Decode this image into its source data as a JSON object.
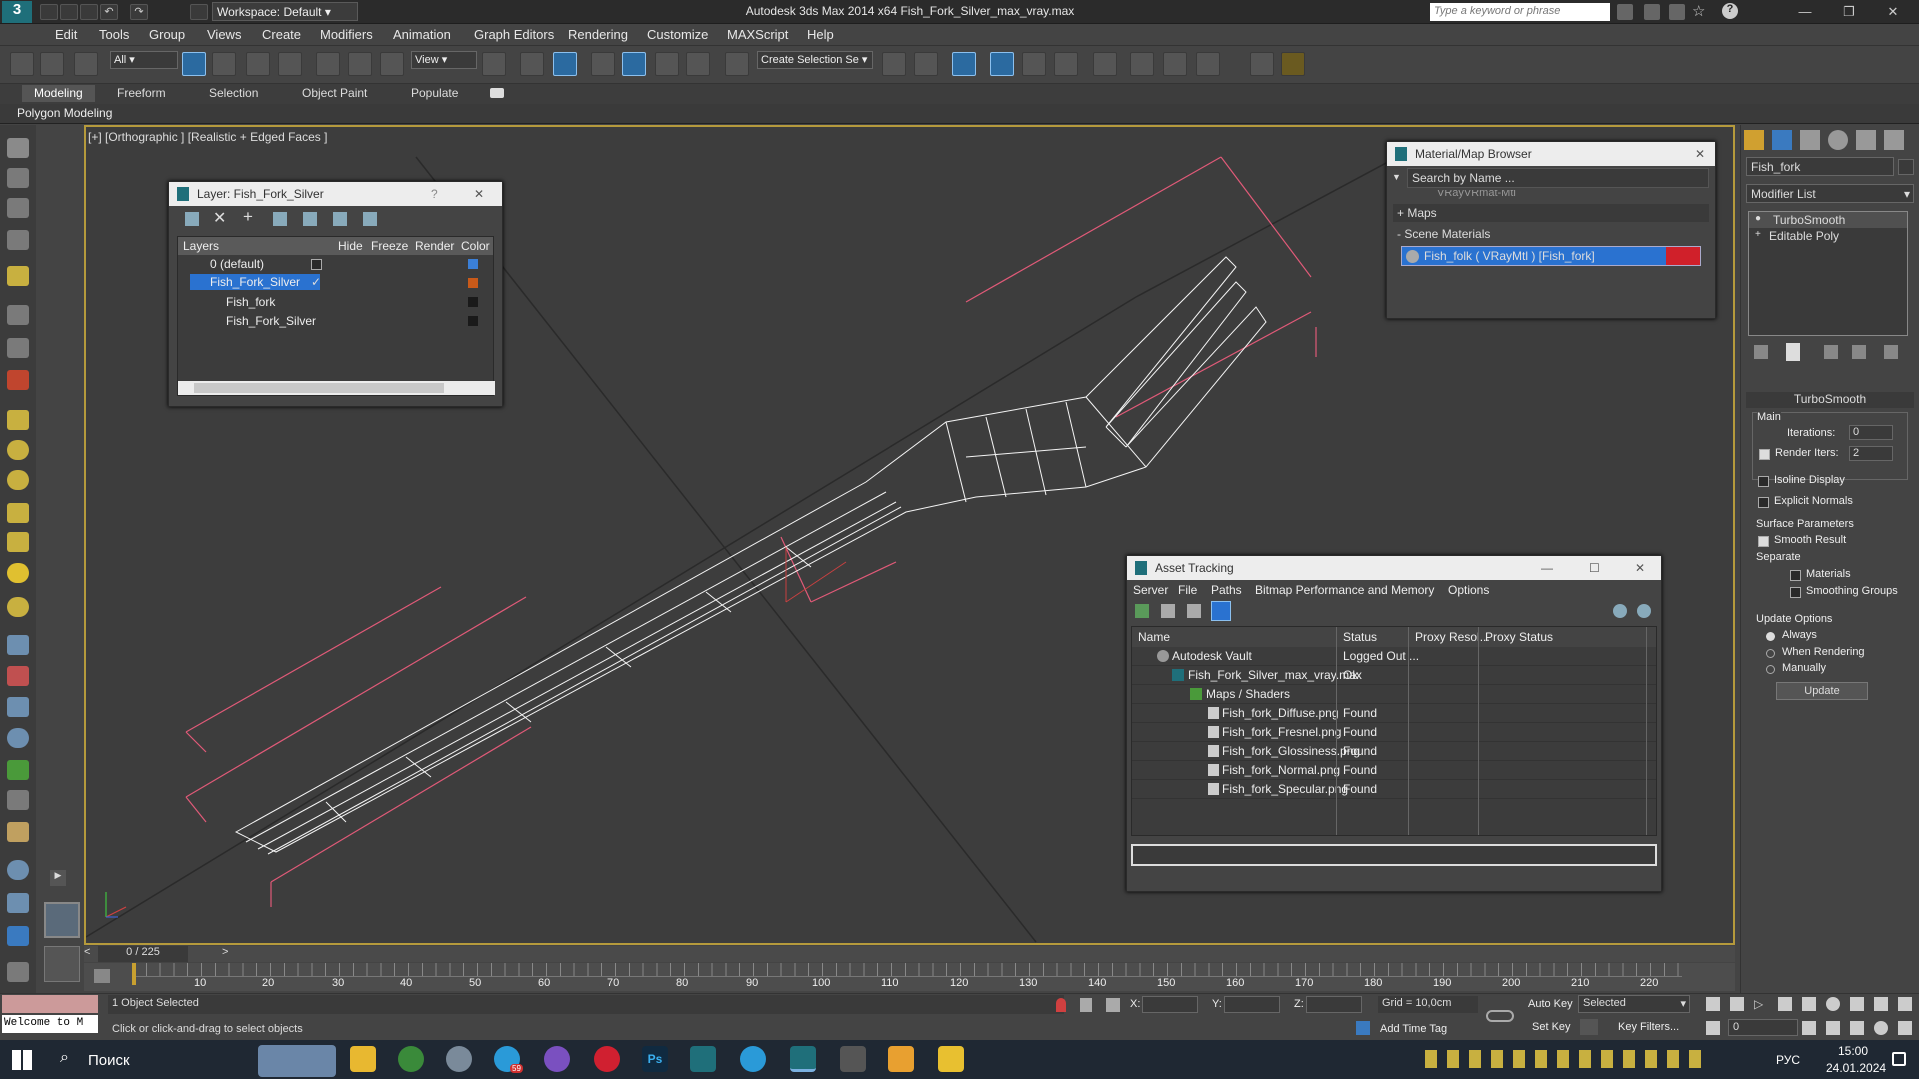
{
  "app": {
    "workspace": "Workspace: Default",
    "title": "Autodesk 3ds Max  2014 x64     Fish_Fork_Silver_max_vray.max",
    "search_placeholder": "Type a keyword or phrase"
  },
  "menu": [
    "Edit",
    "Tools",
    "Group",
    "Views",
    "Create",
    "Modifiers",
    "Animation",
    "Graph Editors",
    "Rendering",
    "Customize",
    "MAXScript",
    "Help"
  ],
  "toolbar": {
    "filter": "All",
    "refcoord": "View",
    "selection_set": "Create Selection Se"
  },
  "ribbon": {
    "tabs": [
      "Modeling",
      "Freeform",
      "Selection",
      "Object Paint",
      "Populate"
    ],
    "subtab": "Polygon Modeling"
  },
  "viewport": {
    "label": "[+] [Orthographic ] [Realistic + Edged Faces ]"
  },
  "layer_panel": {
    "title": "Layer: Fish_Fork_Silver",
    "help": "?",
    "columns": [
      "Layers",
      "Hide",
      "Freeze",
      "Render",
      "Color"
    ],
    "rows": [
      {
        "name": "0 (default)",
        "color": "#3b7fd6"
      },
      {
        "name": "Fish_Fork_Silver",
        "color": "#c85a1a"
      },
      {
        "name": "Fish_fork",
        "color": "#1a1a1a"
      },
      {
        "name": "Fish_Fork_Silver",
        "color": "#1a1a1a"
      }
    ]
  },
  "material_browser": {
    "title": "Material/Map Browser",
    "search": "Search by Name ...",
    "partial": "VRayVRmat-Mtl",
    "maps": "+ Maps",
    "scene_materials": "- Scene Materials",
    "material": "Fish_folk  ( VRayMtl )  [Fish_fork]"
  },
  "asset_tracking": {
    "title": "Asset Tracking",
    "menu": [
      "Server",
      "File",
      "Paths",
      "Bitmap Performance and Memory",
      "Options"
    ],
    "columns": [
      "Name",
      "Status",
      "Proxy Resol...",
      "Proxy Status"
    ],
    "rows": [
      {
        "name": "Autodesk Vault",
        "status": "Logged Out ..."
      },
      {
        "name": "Fish_Fork_Silver_max_vray.max",
        "status": "Ok"
      },
      {
        "name": "Maps / Shaders",
        "status": ""
      },
      {
        "name": "Fish_fork_Diffuse.png",
        "status": "Found"
      },
      {
        "name": "Fish_fork_Fresnel.png",
        "status": "Found"
      },
      {
        "name": "Fish_fork_Glossiness.png",
        "status": "Found"
      },
      {
        "name": "Fish_fork_Normal.png",
        "status": "Found"
      },
      {
        "name": "Fish_fork_Specular.png",
        "status": "Found"
      }
    ]
  },
  "command_panel": {
    "object_name": "Fish_fork",
    "modifier_list": "Modifier List",
    "stack": [
      "TurboSmooth",
      "Editable Poly"
    ],
    "rollout": "TurboSmooth",
    "main": "Main",
    "iterations_label": "Iterations:",
    "iterations": "0",
    "render_iters_label": "Render Iters:",
    "render_iters": "2",
    "isoline": "Isoline Display",
    "explicit": "Explicit Normals",
    "surface": "Surface Parameters",
    "smooth_result": "Smooth Result",
    "separate": "Separate",
    "materials": "Materials",
    "smoothing": "Smoothing Groups",
    "update_options": "Update Options",
    "always": "Always",
    "when_rendering": "When Rendering",
    "manually": "Manually",
    "update": "Update"
  },
  "timeline": {
    "frame": "0 / 225",
    "ticks": [
      "10",
      "20",
      "30",
      "40",
      "50",
      "60",
      "70",
      "80",
      "90",
      "100",
      "110",
      "120",
      "130",
      "140",
      "150",
      "160",
      "170",
      "180",
      "190",
      "200",
      "210",
      "220"
    ]
  },
  "status": {
    "listener": "Welcome to M",
    "selected": "1 Object Selected",
    "prompt": "Click or click-and-drag to select objects",
    "x": "X:",
    "y": "Y:",
    "z": "Z:",
    "grid": "Grid = 10,0cm",
    "add_time_tag": "Add Time Tag",
    "auto_key": "Auto Key",
    "set_key": "Set Key",
    "selected_dd": "Selected",
    "key_filters": "Key Filters...",
    "frame_field": "0"
  },
  "taskbar": {
    "search": "Поиск",
    "lang": "РУС",
    "time": "15:00",
    "date": "24.01.2024",
    "badge": "59"
  }
}
